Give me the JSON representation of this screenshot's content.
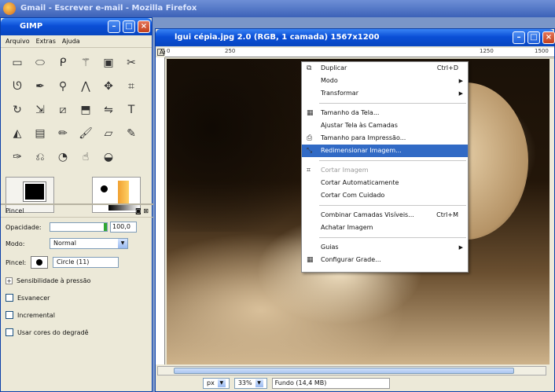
{
  "firefox": {
    "title": "Gmail - Escrever e-mail - Mozilla Firefox"
  },
  "toolbox": {
    "title": "GIMP",
    "menu": [
      "Arquivo",
      "Extras",
      "Ajuda"
    ],
    "tool_icons": [
      "rect-select-icon",
      "ellipse-select-icon",
      "free-select-icon",
      "fuzzy-select-icon",
      "color-select-icon",
      "scissors-icon",
      "paths-icon",
      "color-picker-icon",
      "zoom-icon",
      "measure-icon",
      "move-icon",
      "crop-icon",
      "rotate-icon",
      "scale-icon",
      "shear-icon",
      "perspective-icon",
      "flip-icon",
      "text-icon",
      "bucket-fill-icon",
      "blend-icon",
      "pencil-icon",
      "paintbrush-icon",
      "eraser-icon",
      "airbrush-icon",
      "ink-icon",
      "clone-icon",
      "blur-icon",
      "smudge-icon",
      "dodge-icon"
    ],
    "fg_color": "#000000",
    "bg_color": "#ffffff"
  },
  "tool_options": {
    "title": "Pincel",
    "opacity_label": "Opacidade:",
    "opacity_value": "100,0",
    "mode_label": "Modo:",
    "mode_value": "Normal",
    "brush_label": "Pincel:",
    "brush_value": "Circle (11)",
    "pressure_label": "Sensibilidade à pressão",
    "fade_label": "Esvanecer",
    "incremental_label": "Incremental",
    "gradient_label": "Usar cores do degradê"
  },
  "image_window": {
    "title": "lgui cépia.jpg 2.0 (RGB, 1 camada) 1567x1200",
    "menu": [
      "Arquivo",
      "Editar",
      "Seleção",
      "Visualizar",
      "Imagem",
      "Camada",
      "Ferramentas",
      "Diálogos",
      "Filtros",
      "Script-Fu"
    ],
    "active_menu_index": 4,
    "ruler": [
      "0",
      "250",
      "1250",
      "1500"
    ],
    "unit": "px",
    "zoom": "33%",
    "status": "Fundo (14,4 MB)"
  },
  "image_menu": {
    "items": [
      {
        "label": "Duplicar",
        "shortcut": "Ctrl+D",
        "icon": "duplicate-icon"
      },
      {
        "label": "Modo",
        "submenu": true
      },
      {
        "label": "Transformar",
        "submenu": true
      },
      {
        "sep": true
      },
      {
        "label": "Tamanho da Tela...",
        "icon": "canvas-size-icon"
      },
      {
        "label": "Ajustar Tela às Camadas"
      },
      {
        "label": "Tamanho para Impressão...",
        "icon": "print-size-icon"
      },
      {
        "label": "Redimensionar Imagem...",
        "icon": "scale-image-icon",
        "highlighted": true
      },
      {
        "sep": true
      },
      {
        "label": "Cortar Imagem",
        "icon": "crop-icon",
        "disabled": true
      },
      {
        "label": "Cortar Automaticamente"
      },
      {
        "label": "Cortar Com Cuidado"
      },
      {
        "sep": true
      },
      {
        "label": "Combinar Camadas Visíveis...",
        "shortcut": "Ctrl+M"
      },
      {
        "label": "Achatar Imagem"
      },
      {
        "sep": true
      },
      {
        "label": "Guias",
        "submenu": true
      },
      {
        "label": "Configurar Grade...",
        "icon": "grid-icon"
      }
    ]
  }
}
